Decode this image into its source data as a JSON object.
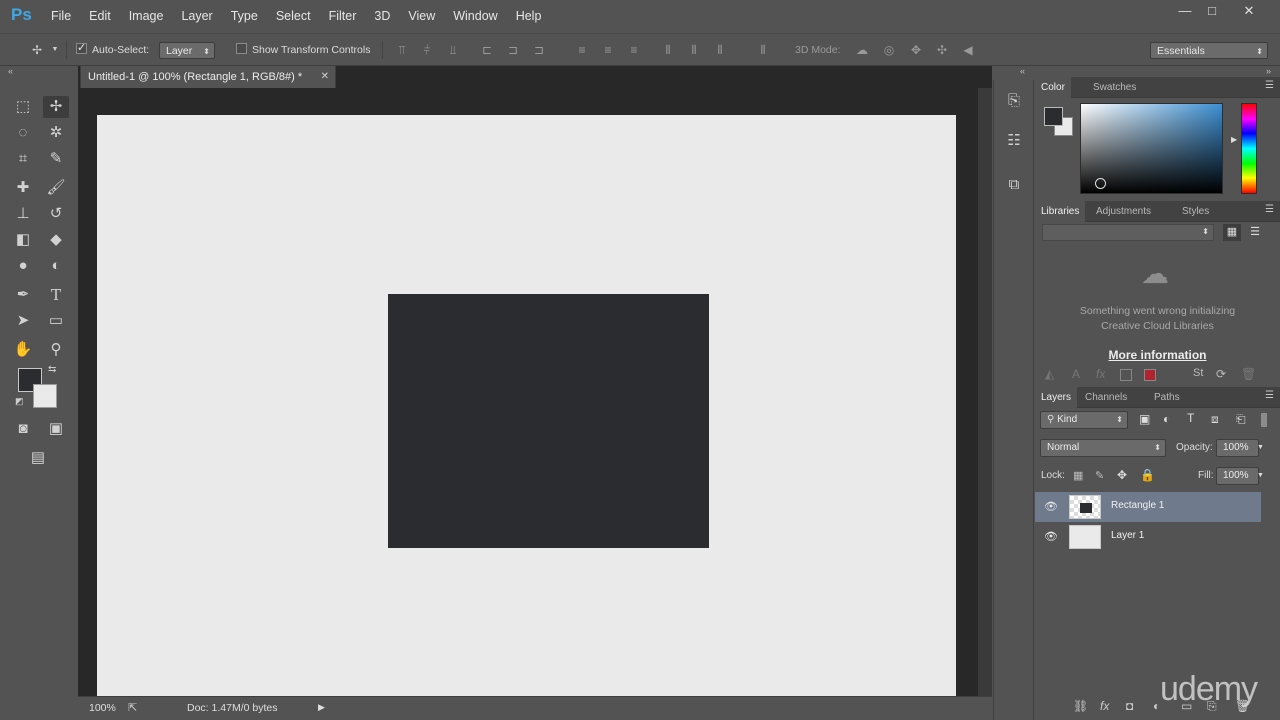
{
  "app": {
    "logo": "Ps"
  },
  "menu": [
    "File",
    "Edit",
    "Image",
    "Layer",
    "Type",
    "Select",
    "Filter",
    "3D",
    "View",
    "Window",
    "Help"
  ],
  "window_controls": [
    "—",
    "□",
    "✕"
  ],
  "options_bar": {
    "auto_select_label": "Auto-Select:",
    "auto_select_checked": true,
    "auto_select_target": "Layer",
    "show_transform_label": "Show Transform Controls",
    "mode_3d_label": "3D Mode:",
    "workspace": "Essentials"
  },
  "document": {
    "tab_title": "Untitled-1 @ 100% (Rectangle 1, RGB/8#) *",
    "rectangle_color": "#2b2c2f",
    "canvas_color": "#eaeaea"
  },
  "status_bar": {
    "zoom": "100%",
    "doc_info": "Doc: 1.47M/0 bytes"
  },
  "color_panel": {
    "tabs": [
      "Color",
      "Swatches"
    ],
    "active_tab": "Color",
    "foreground": "#2b2c2f",
    "background": "#eaeaea"
  },
  "libraries_panel": {
    "tabs": [
      "Libraries",
      "Adjustments",
      "Styles"
    ],
    "error_line1": "Something went wrong initializing",
    "error_line2": "Creative Cloud Libraries",
    "more_info": "More information"
  },
  "layers_panel": {
    "tabs": [
      "Layers",
      "Channels",
      "Paths"
    ],
    "filter_kind": "Kind",
    "blend_mode": "Normal",
    "opacity_label": "Opacity:",
    "opacity": "100%",
    "lock_label": "Lock:",
    "fill_label": "Fill:",
    "fill": "100%",
    "layers": [
      {
        "name": "Rectangle 1",
        "selected": true
      },
      {
        "name": "Layer 1",
        "selected": false
      }
    ]
  },
  "watermark": "udemy"
}
